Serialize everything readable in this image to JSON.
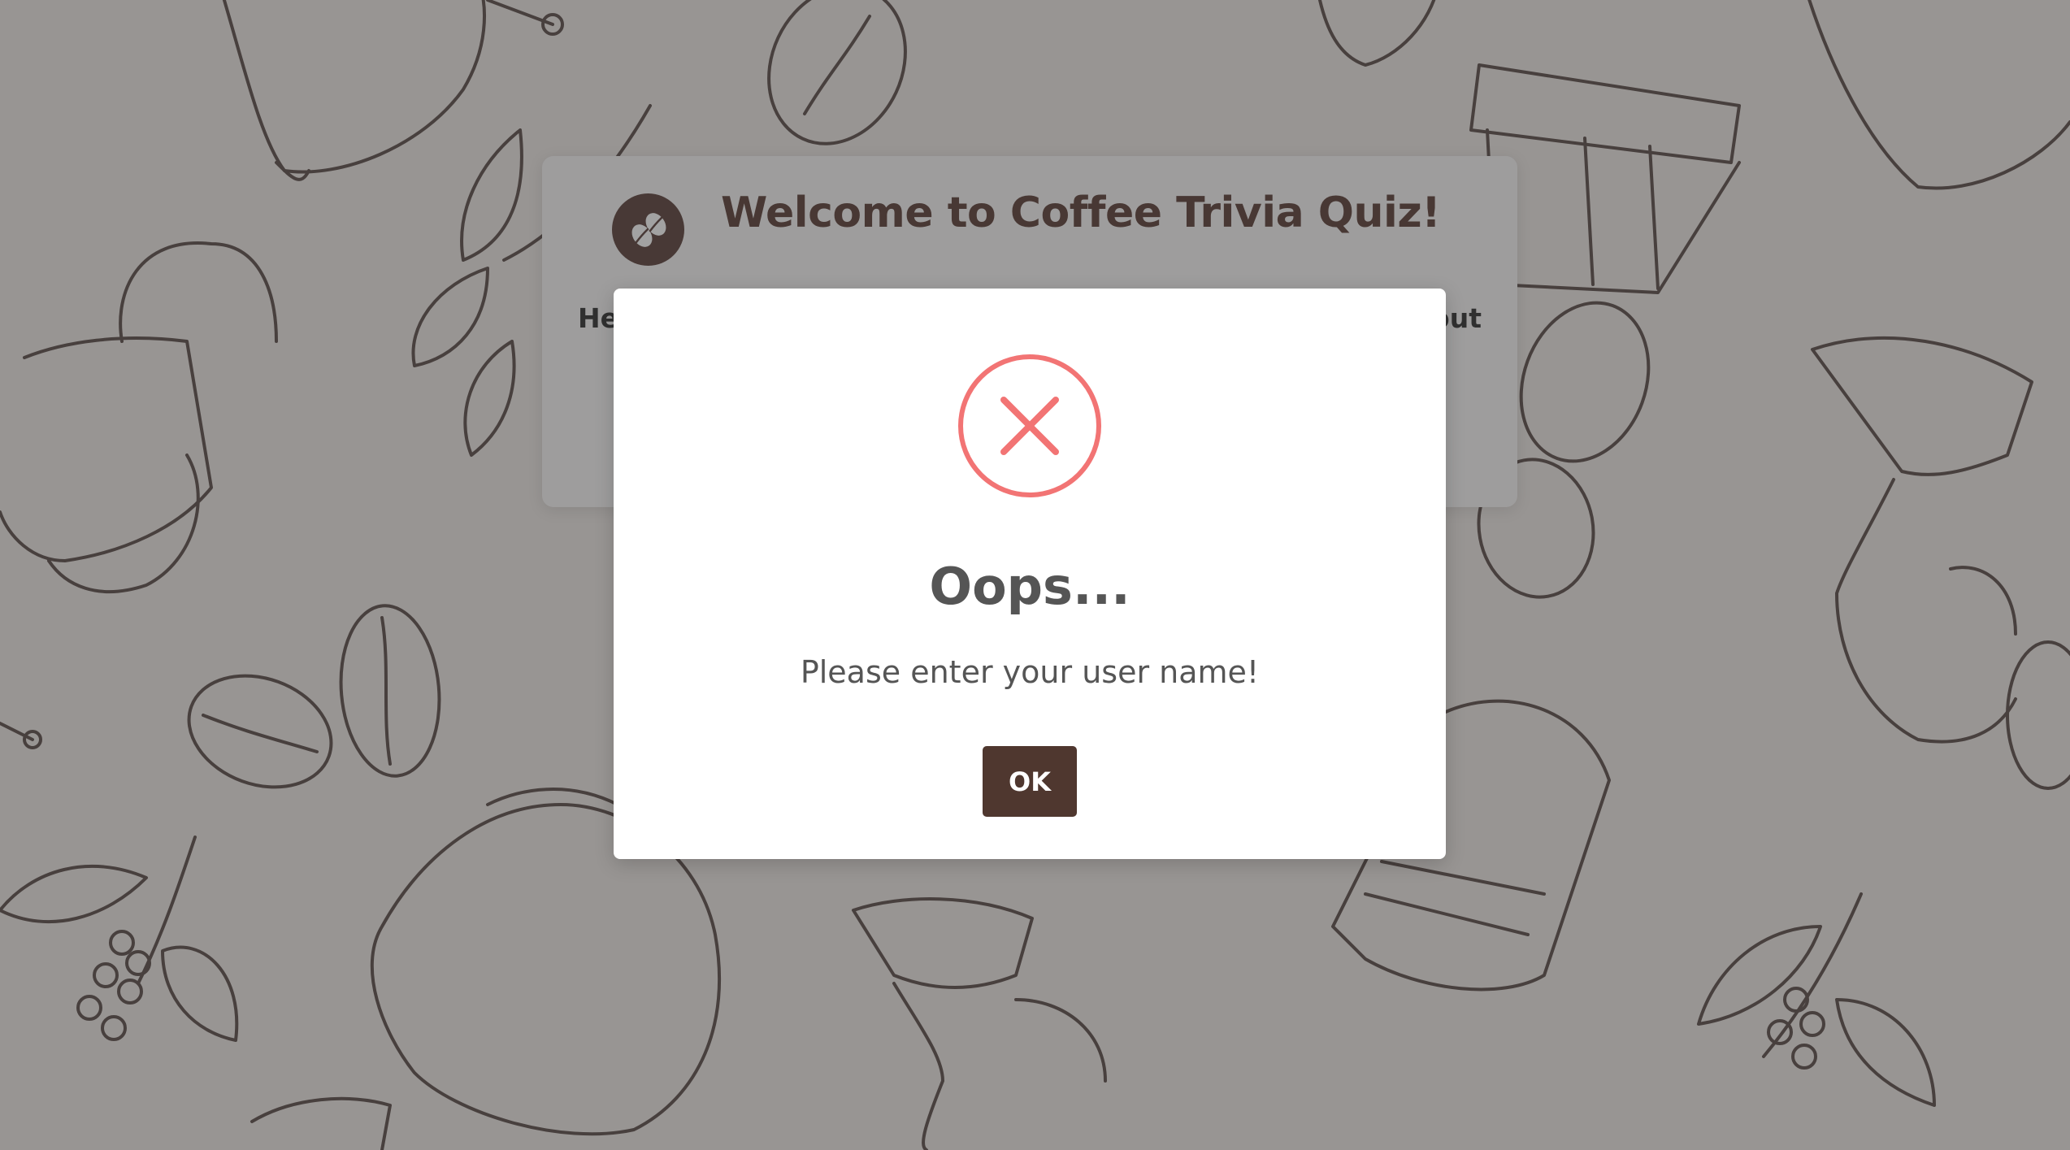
{
  "quiz": {
    "title": "Welcome to Coffee Trivia Quiz!",
    "intro_text_left": "He",
    "intro_text_right": "out",
    "logo_icon": "coffee-beans-icon"
  },
  "dialog": {
    "icon": "error-x-icon",
    "title": "Oops...",
    "message": "Please enter your user name!",
    "confirm_label": "OK"
  },
  "colors": {
    "brand_brown": "#4a2d26",
    "button_brown": "#4f372f",
    "error_red": "#f27474",
    "text_gray": "#555555"
  },
  "background": {
    "pattern": "hand-drawn coffee illustrations (beans, bags, pour-over drippers, cups, coffee branches)"
  }
}
